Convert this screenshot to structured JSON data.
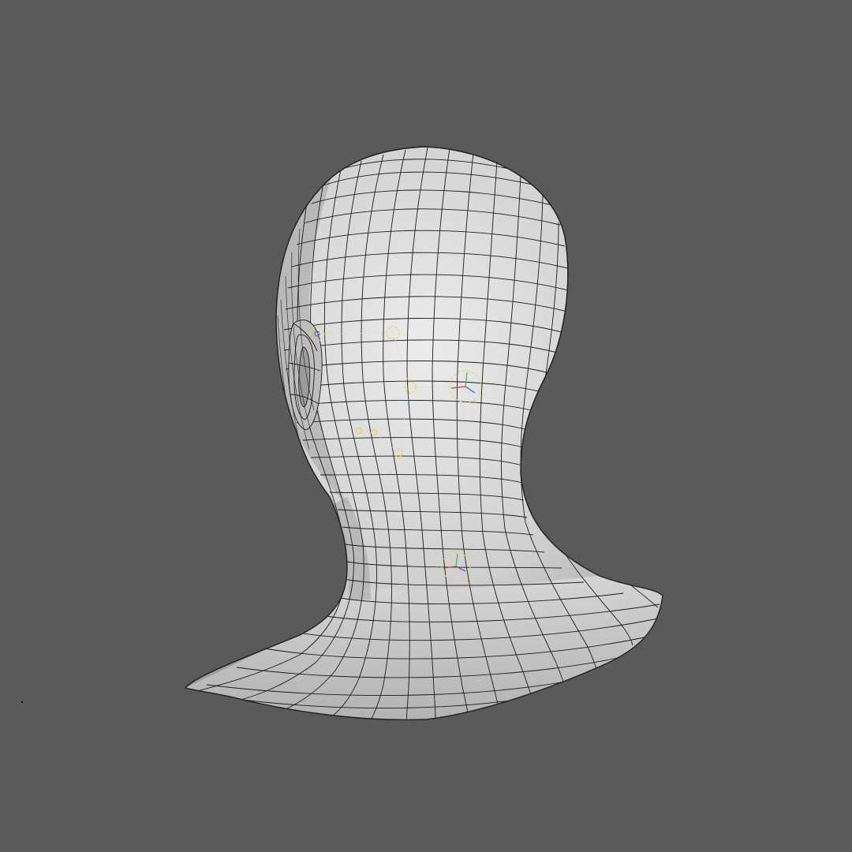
{
  "viewport": {
    "background": "#5a5a5a",
    "mesh_fill": "#d6d6d6",
    "mesh_edge": "#1a1a1a",
    "shadow": "#8c8c8c"
  },
  "rig": {
    "locator_color": "#e8d44a",
    "guide_color": "#d0d0d0",
    "axis_colors": {
      "x": "#d04040",
      "y": "#40c040",
      "z": "#4060d0"
    }
  }
}
